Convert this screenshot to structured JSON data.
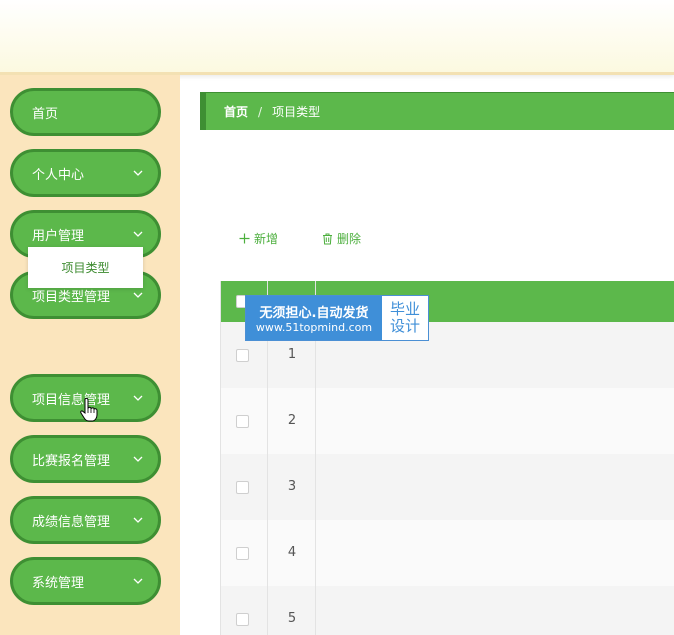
{
  "sidebar": {
    "items": [
      {
        "label": "首页",
        "has_chevron": false
      },
      {
        "label": "个人中心",
        "has_chevron": true
      },
      {
        "label": "用户管理",
        "has_chevron": true
      },
      {
        "label": "项目类型管理",
        "has_chevron": true
      },
      {
        "label": "项目信息管理",
        "has_chevron": true
      },
      {
        "label": "比赛报名管理",
        "has_chevron": true
      },
      {
        "label": "成绩信息管理",
        "has_chevron": true
      },
      {
        "label": "系统管理",
        "has_chevron": true
      }
    ],
    "submenu_label": "项目类型"
  },
  "breadcrumb": {
    "home": "首页",
    "separator": "/",
    "current": "项目类型"
  },
  "toolbar": {
    "add_label": "新增",
    "delete_label": "删除"
  },
  "table": {
    "rows": [
      "1",
      "2",
      "3",
      "4",
      "5"
    ]
  },
  "watermark": {
    "line1": "无须担心.自动发货",
    "line2": "www.51topmind.com",
    "right1": "毕业",
    "right2": "设计"
  },
  "colors": {
    "primary": "#5cb84b",
    "primary_dark": "#3e8f33",
    "sidebar_bg": "#fbe5bd",
    "watermark_blue": "#3f8fd8"
  }
}
